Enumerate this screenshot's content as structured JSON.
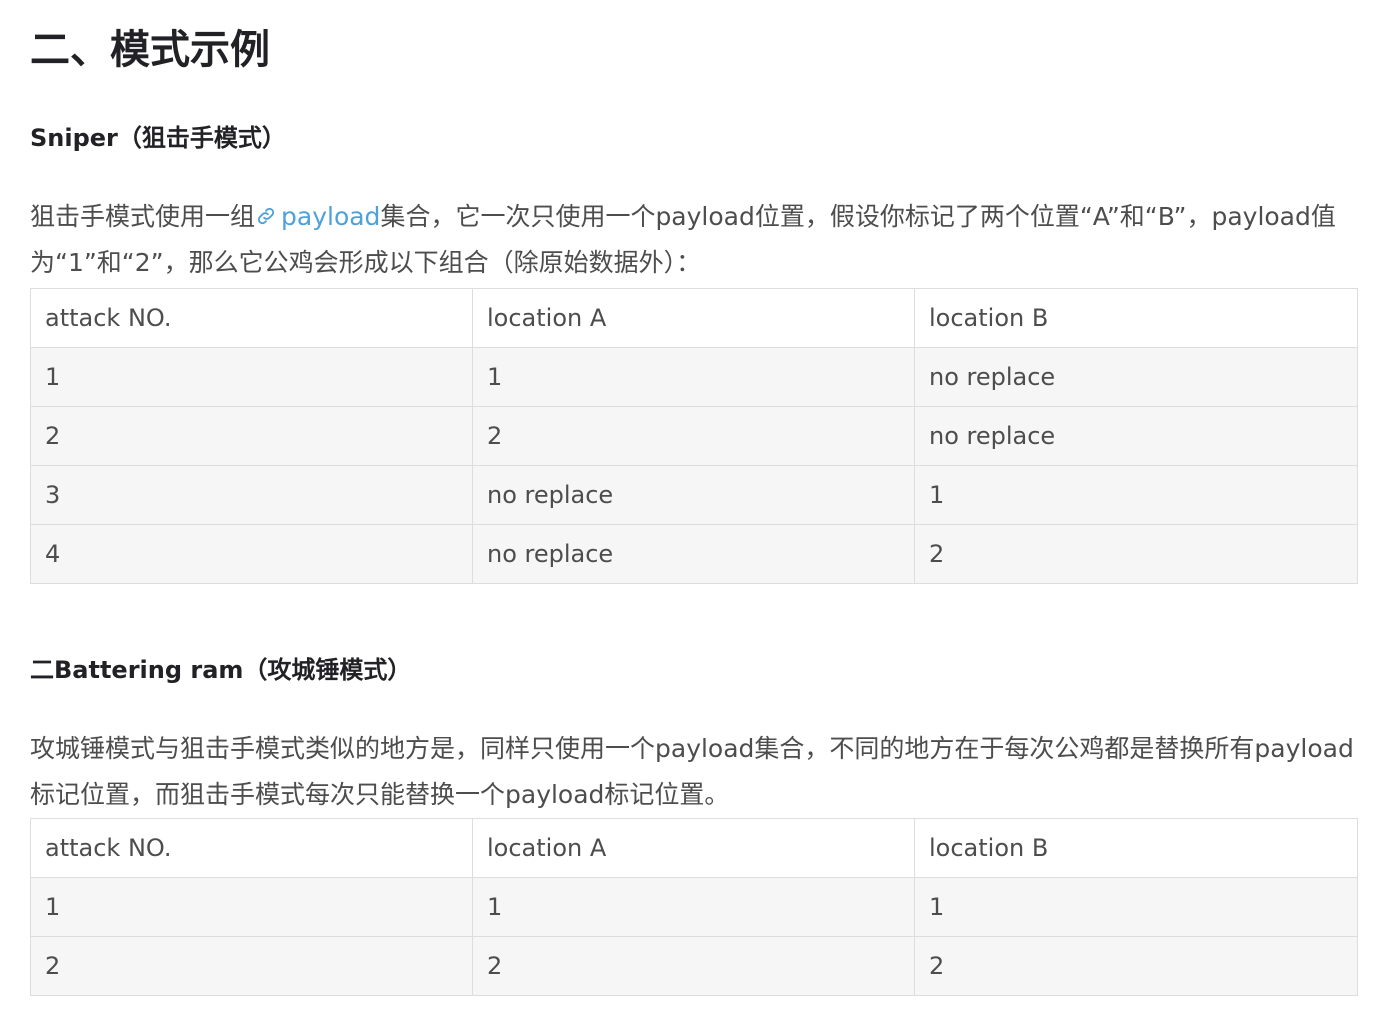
{
  "section_title": "二、模式示例",
  "sniper": {
    "title": "Sniper（狙击手模式）",
    "para_before_link": "狙击手模式使用一组",
    "link_icon": "link-icon",
    "link_text": "payload",
    "para_after_link": "集合，它一次只使用一个payload位置，假设你标记了两个位置“A”和“B”，payload值为“1”和“2”，那么它公鸡会形成以下组合（除原始数据外）：",
    "table": {
      "headers": [
        "attack NO.",
        "location A",
        "location B"
      ],
      "rows": [
        [
          "1",
          "1",
          "no replace"
        ],
        [
          "2",
          "2",
          "no replace"
        ],
        [
          "3",
          "no replace",
          "1"
        ],
        [
          "4",
          "no replace",
          "2"
        ]
      ]
    }
  },
  "battering_ram": {
    "title": "二Battering ram（攻城锤模式）",
    "para": "攻城锤模式与狙击手模式类似的地方是，同样只使用一个payload集合，不同的地方在于每次公鸡都是替换所有payload标记位置，而狙击手模式每次只能替换一个payload标记位置。",
    "table": {
      "headers": [
        "attack NO.",
        "location A",
        "location B"
      ],
      "rows": [
        [
          "1",
          "1",
          "1"
        ],
        [
          "2",
          "2",
          "2"
        ]
      ]
    }
  },
  "colors": {
    "heading": "#222226",
    "body_text": "#4d4d4d",
    "link": "#4ea1db",
    "table_border": "#dddddd",
    "table_row_bg": "#f6f6f6"
  }
}
